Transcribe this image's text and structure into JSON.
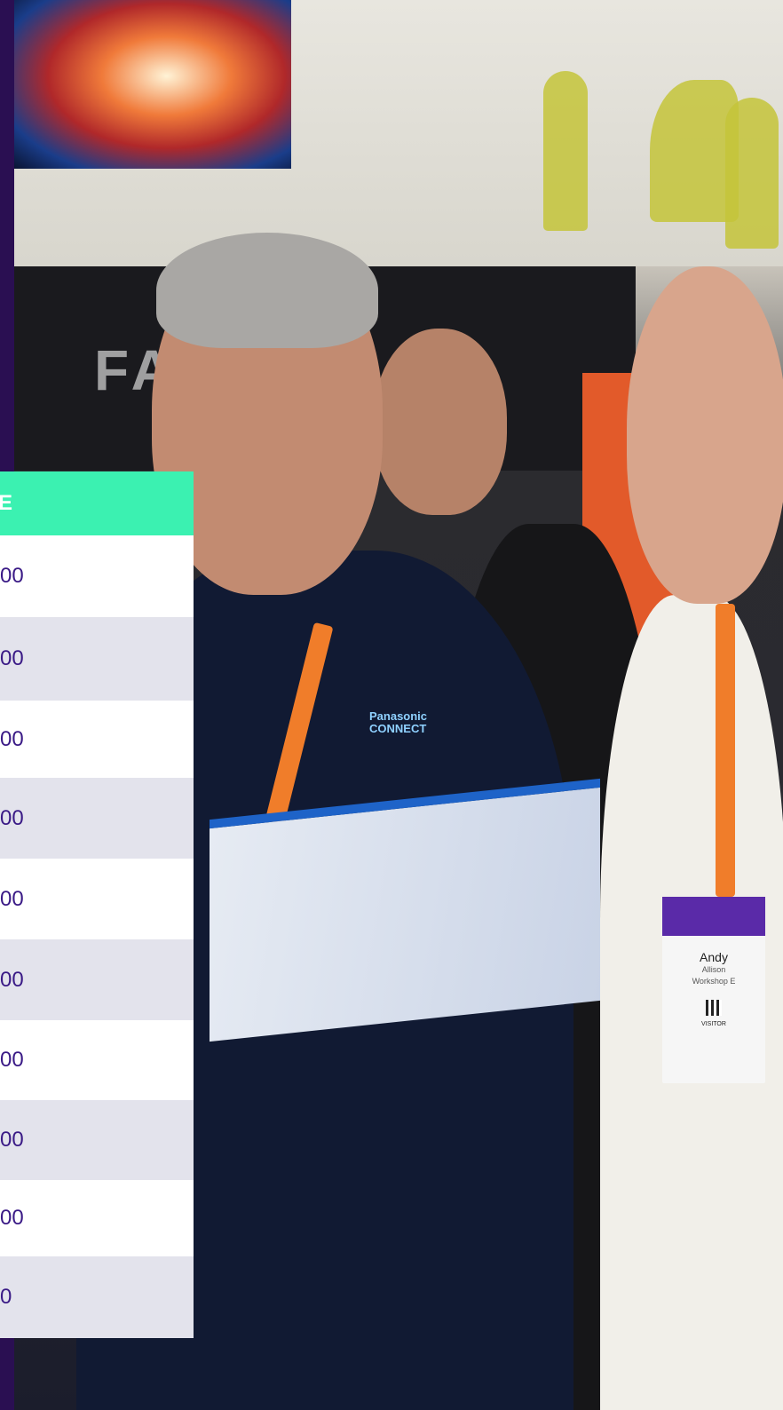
{
  "table": {
    "header": "E",
    "rows": [
      "00",
      "00",
      "00",
      "00",
      "00",
      "00",
      "00",
      "00",
      "00",
      "0"
    ]
  },
  "photo": {
    "booth_sign": "FA",
    "logo_line1": "Panasonic",
    "logo_line2": "CONNECT",
    "badge": {
      "name": "Andy",
      "company": "Allison",
      "session": "Workshop E",
      "role": "VISITOR"
    }
  },
  "colors": {
    "header_bg": "#3bf1b1",
    "row_text": "#3a1a86",
    "row_alt_bg": "#e3e3ec",
    "page_bg": "#1e0b3f"
  }
}
